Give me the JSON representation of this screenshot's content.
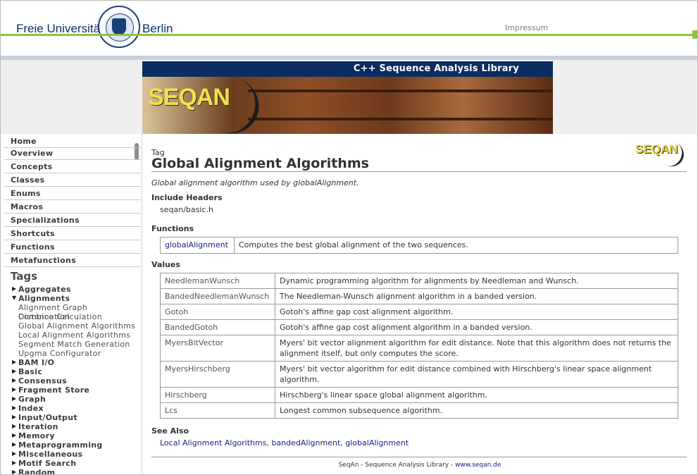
{
  "header": {
    "brand_left": "Freie Universität",
    "brand_right": "Berlin",
    "impressum": "Impressum"
  },
  "banner": {
    "title": "C++ Sequence Analysis Library",
    "logo_text": "SEQAN"
  },
  "sidebar": {
    "nav": [
      "Home",
      "Overview",
      "Concepts",
      "Classes",
      "Enums",
      "Macros",
      "Specializations",
      "Shortcuts",
      "Functions",
      "Metafunctions"
    ],
    "tags_heading": "Tags",
    "tags": [
      {
        "label": "Aggregates",
        "expanded": false
      },
      {
        "label": "Alignments",
        "expanded": true,
        "children": [
          "Alignment Graph Combination",
          "Distance Calculation",
          "Global Alignment Algorithms",
          "Local Alignment Algorithms",
          "Segment Match Generation",
          "Upgma Configurator"
        ]
      },
      {
        "label": "BAM I/O",
        "expanded": false
      },
      {
        "label": "Basic",
        "expanded": false
      },
      {
        "label": "Consensus",
        "expanded": false
      },
      {
        "label": "Fragment Store",
        "expanded": false
      },
      {
        "label": "Graph",
        "expanded": false
      },
      {
        "label": "Index",
        "expanded": false
      },
      {
        "label": "Input/Output",
        "expanded": false
      },
      {
        "label": "Iteration",
        "expanded": false
      },
      {
        "label": "Memory",
        "expanded": false
      },
      {
        "label": "Metaprogramming",
        "expanded": false
      },
      {
        "label": "Miscellaneous",
        "expanded": false
      },
      {
        "label": "Motif Search",
        "expanded": false
      },
      {
        "label": "Random",
        "expanded": false
      }
    ]
  },
  "main": {
    "kind": "Tag",
    "title": "Global Alignment Algorithms",
    "logo_text": "SEQAN",
    "description": "Global alignment algorithm used by globalAlignment.",
    "include_heading": "Include Headers",
    "include_file": "seqan/basic.h",
    "functions_heading": "Functions",
    "functions": [
      {
        "name": "globalAlignment",
        "desc": "Computes the best global alignment of the two sequences."
      }
    ],
    "values_heading": "Values",
    "values": [
      {
        "name": "NeedlemanWunsch",
        "desc": "Dynamic programming algorithm for alignments by Needleman and Wunsch."
      },
      {
        "name": "BandedNeedlemanWunsch",
        "desc": "The Needleman-Wunsch alignment algorithm in a banded version."
      },
      {
        "name": "Gotoh",
        "desc": "Gotoh's affine gap cost alignment algorithm."
      },
      {
        "name": "BandedGotoh",
        "desc": "Gotoh's affine gap cost alignment algorithm in a banded version."
      },
      {
        "name": "MyersBitVector",
        "desc": "Myers' bit vector alignment algorithm for edit distance. Note that this algorithm does not returns the alignment itself, but only computes the score."
      },
      {
        "name": "MyersHirschberg",
        "desc": "Myers' bit vector algorithm for edit distance combined with Hirschberg's linear space alignment algorithm."
      },
      {
        "name": "Hirschberg",
        "desc": "Hirschberg's linear space global alignment algorithm."
      },
      {
        "name": "Lcs",
        "desc": "Longest common subsequence algorithm."
      }
    ],
    "see_also_heading": "See Also",
    "see_also": [
      "Local Alignment Algorithms",
      "bandedAlignment",
      "globalAlignment"
    ],
    "footer_text": "SeqAn - Sequence Analysis Library - ",
    "footer_link": "www.seqan.de"
  },
  "colors": {
    "accent_green": "#8fc33a",
    "navy": "#0b2d63",
    "link": "#1a237e"
  }
}
